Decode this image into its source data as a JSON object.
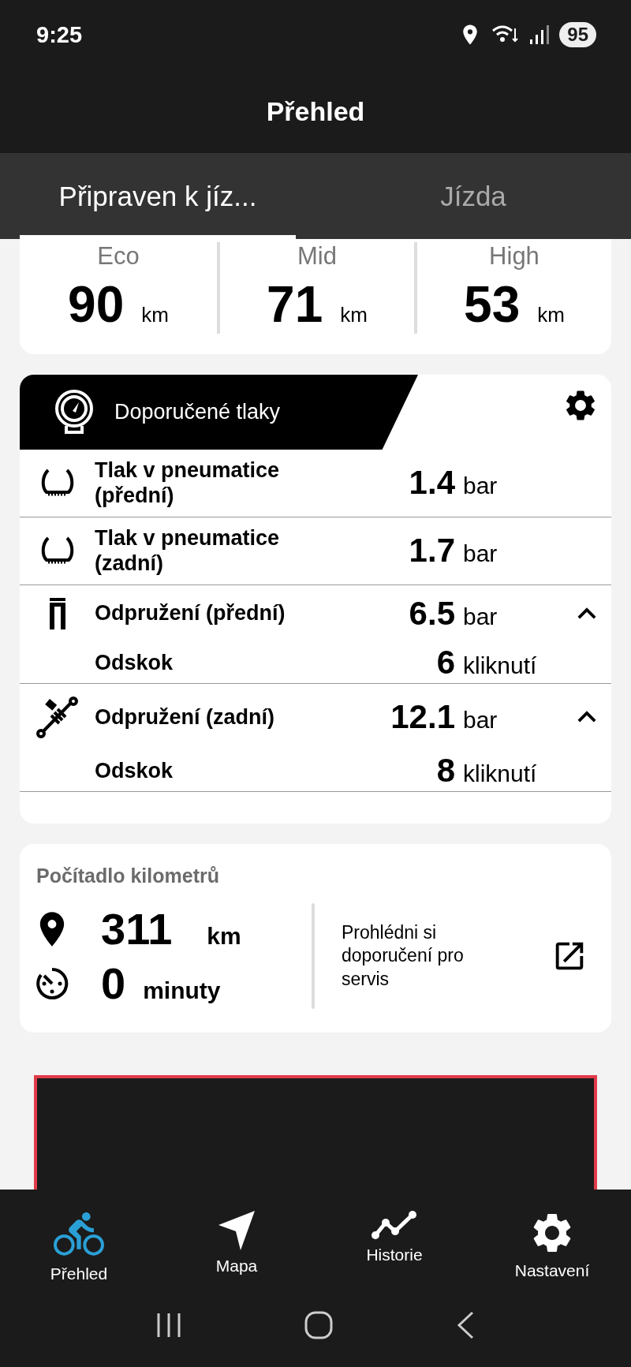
{
  "status_bar": {
    "time": "9:25",
    "battery": "95"
  },
  "header": {
    "title": "Přehled"
  },
  "tabs": [
    {
      "label": "Připraven k jíz...",
      "selected": true
    },
    {
      "label": "Jízda",
      "selected": false
    }
  ],
  "range": [
    {
      "mode": "Eco",
      "value": "90",
      "unit": "km"
    },
    {
      "mode": "Mid",
      "value": "71",
      "unit": "km"
    },
    {
      "mode": "High",
      "value": "53",
      "unit": "km"
    }
  ],
  "pressures": {
    "title": "Doporučené tlaky",
    "rows": [
      {
        "kind": "tire",
        "label": "Tlak v pneumatice (přední)",
        "value": "1.4",
        "unit": "bar"
      },
      {
        "kind": "tire",
        "label": "Tlak v pneumatice (zadní)",
        "value": "1.7",
        "unit": "bar"
      },
      {
        "kind": "fork",
        "label": "Odpružení (přední)",
        "value": "6.5",
        "unit": "bar",
        "expanded": true,
        "sub": {
          "label": "Odskok",
          "value": "6",
          "unit": "kliknutí"
        }
      },
      {
        "kind": "shock",
        "label": "Odpružení (zadní)",
        "value": "12.1",
        "unit": "bar",
        "expanded": true,
        "sub": {
          "label": "Odskok",
          "value": "8",
          "unit": "kliknutí"
        }
      }
    ]
  },
  "odometer": {
    "title": "Počítadlo kilometrů",
    "distance": {
      "value": "311",
      "unit": "km"
    },
    "duration": {
      "value": "0",
      "unit": "minuty"
    },
    "service_link": "Prohlédni si doporučení pro servis"
  },
  "bottom_nav": [
    {
      "kind": "bike",
      "label": "Přehled",
      "selected": true
    },
    {
      "kind": "map",
      "label": "Mapa",
      "selected": false
    },
    {
      "kind": "history",
      "label": "Historie",
      "selected": false
    },
    {
      "kind": "settings",
      "label": "Nastavení",
      "selected": false
    }
  ]
}
